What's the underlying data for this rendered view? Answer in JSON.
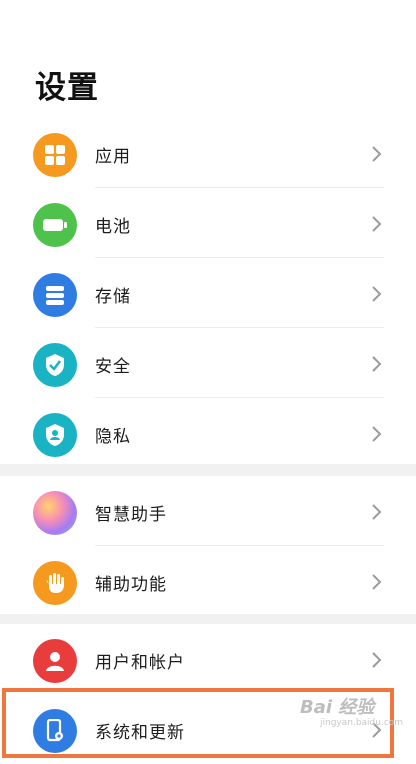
{
  "page": {
    "title": "设置"
  },
  "groups": [
    {
      "items": [
        {
          "label": "应用",
          "icon": "apps-icon",
          "color": "#f59a1f"
        },
        {
          "label": "电池",
          "icon": "battery-icon",
          "color": "#4fc24c"
        },
        {
          "label": "存储",
          "icon": "storage-icon",
          "color": "#2f7de2"
        },
        {
          "label": "安全",
          "icon": "shield-check-icon",
          "color": "#19b3c3"
        },
        {
          "label": "隐私",
          "icon": "privacy-shield-icon",
          "color": "#19b3c3"
        }
      ]
    },
    {
      "items": [
        {
          "label": "智慧助手",
          "icon": "smart-assistant-icon",
          "color": "#c97ce8"
        },
        {
          "label": "辅助功能",
          "icon": "hand-icon",
          "color": "#f59a1f"
        }
      ]
    },
    {
      "items": [
        {
          "label": "用户和帐户",
          "icon": "user-icon",
          "color": "#e93c3c"
        },
        {
          "label": "系统和更新",
          "icon": "phone-settings-icon",
          "color": "#2f7de2"
        }
      ]
    }
  ],
  "watermark": {
    "text": "Bai 经验",
    "sub": "jingyan.baidu.com"
  },
  "colors": {
    "highlight": "#f0773c",
    "background": "#ffffff",
    "band": "#f1f1f1"
  }
}
